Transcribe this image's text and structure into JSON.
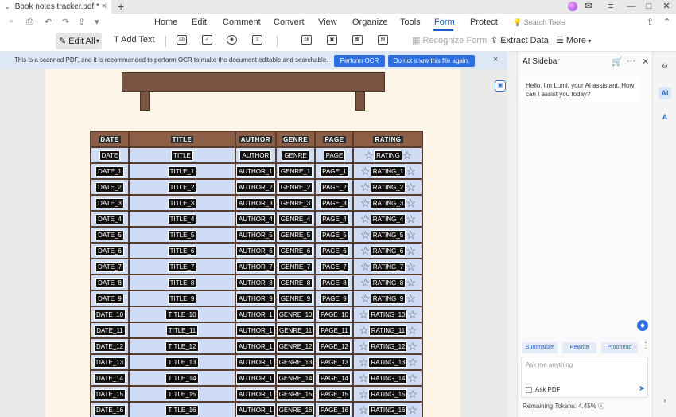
{
  "window": {
    "tab_title": "Book notes tracker.pdf *",
    "tab_caret": "⌄",
    "tab_close": "×",
    "new_tab": "+",
    "controls": {
      "minimize": "—",
      "maximize": "□",
      "close": "✕"
    }
  },
  "menu": {
    "items": [
      "Home",
      "Edit",
      "Comment",
      "Convert",
      "View",
      "Organize",
      "Tools",
      "Form",
      "Protect"
    ],
    "active": "Form",
    "search_placeholder": "Search Tools"
  },
  "toolbar": {
    "edit_all": "Edit All",
    "add_text": "Add Text",
    "recognize_form": "Recognize Form",
    "extract_data": "Extract Data",
    "more": "More",
    "form_icons": [
      "ab",
      "✓",
      "◉",
      "≡",
      "ok",
      "▣",
      "▦",
      "▤"
    ]
  },
  "ocr_banner": {
    "message": "This is a scanned PDF, and it is recommended to perform OCR to make the document editable and searchable.",
    "perform_ocr": "Perform OCR",
    "dont_show": "Do not show this file again.",
    "close": "×"
  },
  "table": {
    "headers": [
      "DATE",
      "TITLE",
      "AUTHOR",
      "GENRE",
      "PAGE",
      "RATING"
    ],
    "rows": [
      [
        "DATE",
        "TITLE",
        "AUTHOR",
        "GENRE",
        "PAGE",
        "RATING"
      ],
      [
        "DATE_1",
        "TITLE_1",
        "AUTHOR_1",
        "GENRE_1",
        "PAGE_1",
        "RATING_1"
      ],
      [
        "DATE_2",
        "TITLE_2",
        "AUTHOR_2",
        "GENRE_2",
        "PAGE_2",
        "RATING_2"
      ],
      [
        "DATE_3",
        "TITLE_3",
        "AUTHOR_3",
        "GENRE_3",
        "PAGE_3",
        "RATING_3"
      ],
      [
        "DATE_4",
        "TITLE_4",
        "AUTHOR_4",
        "GENRE_4",
        "PAGE_4",
        "RATING_4"
      ],
      [
        "DATE_5",
        "TITLE_5",
        "AUTHOR_5",
        "GENRE_5",
        "PAGE_5",
        "RATING_5"
      ],
      [
        "DATE_6",
        "TITLE_6",
        "AUTHOR_6",
        "GENRE_6",
        "PAGE_6",
        "RATING_6"
      ],
      [
        "DATE_7",
        "TITLE_7",
        "AUTHOR_7",
        "GENRE_7",
        "PAGE_7",
        "RATING_7"
      ],
      [
        "DATE_8",
        "TITLE_8",
        "AUTHOR_8",
        "GENRE_8",
        "PAGE_8",
        "RATING_8"
      ],
      [
        "DATE_9",
        "TITLE_9",
        "AUTHOR_9",
        "GENRE_9",
        "PAGE_9",
        "RATING_9"
      ],
      [
        "DATE_10",
        "TITLE_10",
        "AUTHOR_1",
        "GENRE_10",
        "PAGE_10",
        "RATING_10"
      ],
      [
        "DATE_11",
        "TITLE_11",
        "AUTHOR_1",
        "GENRE_11",
        "PAGE_11",
        "RATING_11"
      ],
      [
        "DATE_12",
        "TITLE_12",
        "AUTHOR_1",
        "GENRE_12",
        "PAGE_12",
        "RATING_12"
      ],
      [
        "DATE_13",
        "TITLE_13",
        "AUTHOR_1",
        "GENRE_13",
        "PAGE_13",
        "RATING_13"
      ],
      [
        "DATE_14",
        "TITLE_14",
        "AUTHOR_1",
        "GENRE_14",
        "PAGE_14",
        "RATING_14"
      ],
      [
        "DATE_15",
        "TITLE_15",
        "AUTHOR_1",
        "GENRE_15",
        "PAGE_15",
        "RATING_15"
      ],
      [
        "DATE_16",
        "TITLE_16",
        "AUTHOR_1",
        "GENRE_16",
        "PAGE_16",
        "RATING_16"
      ]
    ]
  },
  "sidebar": {
    "title": "AI Sidebar",
    "greeting": "Hello, I'm Lumi, your AI assistant. How can I assist you today?",
    "chips": [
      "Summarize",
      "Rewrite",
      "Proofread"
    ],
    "ask_placeholder": "Ask me anything",
    "ask_pdf": "Ask PDF",
    "tokens": "Remaining Tokens: 4.45%"
  },
  "colors": {
    "accent": "#2d6fe0",
    "shelf": "#7a5541",
    "cell": "#cfdcf5",
    "page": "#fdf5e8"
  }
}
